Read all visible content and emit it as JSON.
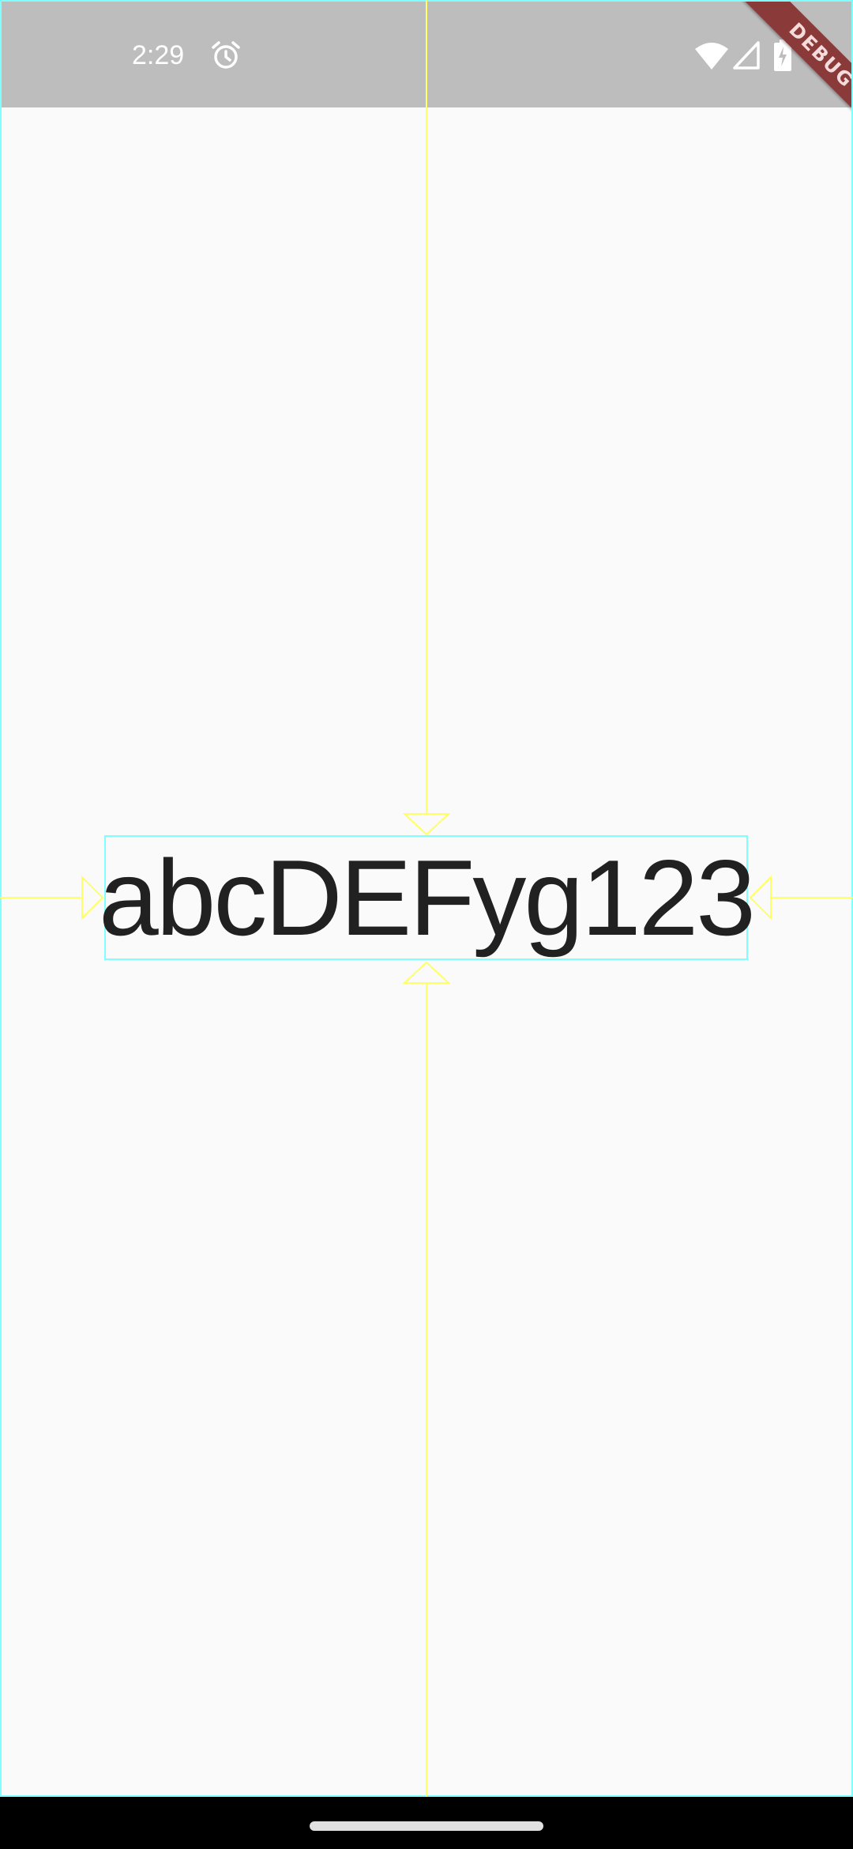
{
  "status_bar": {
    "time": "2:29",
    "icons": [
      "alarm-icon",
      "wifi-icon",
      "signal-icon",
      "battery-charging-icon"
    ]
  },
  "debug_banner": {
    "label": "DEBUG"
  },
  "main": {
    "sample_text": "abcDEFyg123"
  },
  "colors": {
    "background": "#fafafa",
    "status_bar": "#bdbdbd",
    "text": "#212121",
    "debug_ribbon": "#8b3a3a",
    "guide_yellow": "#ffff66",
    "guide_cyan": "#80ffff"
  },
  "icons": {
    "nav": "home-handle"
  }
}
